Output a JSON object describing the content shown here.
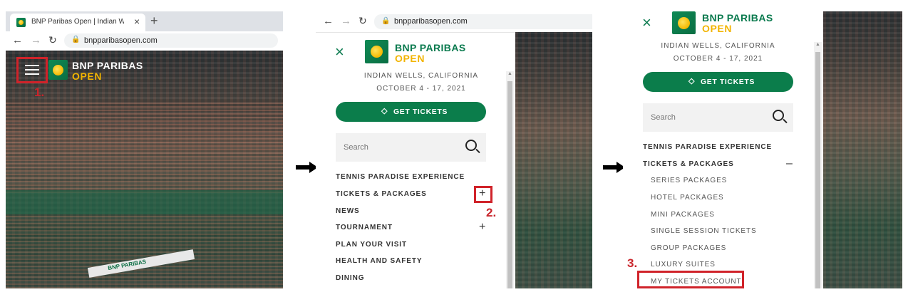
{
  "panel1": {
    "tab_title": "BNP Paribas Open | Indian Wells",
    "new_tab": "+",
    "url": "bnpparibasopen.com",
    "logo_line1": "BNP PARIBAS",
    "logo_line2": "OPEN",
    "step": "1.",
    "banner_text": "BNP PARIBAS"
  },
  "panel2": {
    "url": "bnpparibasopen.com",
    "logo_line1": "BNP PARIBAS",
    "logo_line2": "OPEN",
    "location": "INDIAN WELLS, CALIFORNIA",
    "dates": "OCTOBER 4 - 17, 2021",
    "get_tickets": "GET TICKETS",
    "search_placeholder": "Search",
    "menu": [
      {
        "label": "TENNIS PARADISE EXPERIENCE"
      },
      {
        "label": "TICKETS & PACKAGES",
        "toggle": "+"
      },
      {
        "label": "NEWS"
      },
      {
        "label": "TOURNAMENT",
        "toggle": "+"
      },
      {
        "label": "PLAN YOUR VISIT"
      },
      {
        "label": "HEALTH AND SAFETY"
      },
      {
        "label": "DINING"
      }
    ],
    "step": "2."
  },
  "panel3": {
    "logo_line1": "BNP PARIBAS",
    "logo_line2": "OPEN",
    "location": "INDIAN WELLS, CALIFORNIA",
    "dates": "OCTOBER 4 - 17, 2021",
    "get_tickets": "GET TICKETS",
    "search_placeholder": "Search",
    "menu": [
      {
        "label": "TENNIS PARADISE EXPERIENCE"
      },
      {
        "label": "TICKETS & PACKAGES",
        "toggle": "–"
      }
    ],
    "submenu": [
      "SERIES PACKAGES",
      "HOTEL PACKAGES",
      "MINI PACKAGES",
      "SINGLE SESSION TICKETS",
      "GROUP PACKAGES",
      "LUXURY SUITES",
      "MY TICKETS ACCOUNT"
    ],
    "step": "3."
  },
  "colors": {
    "brand_green": "#0b7d4b",
    "logo_gold": "#f2b400",
    "highlight_red": "#d0232a"
  }
}
